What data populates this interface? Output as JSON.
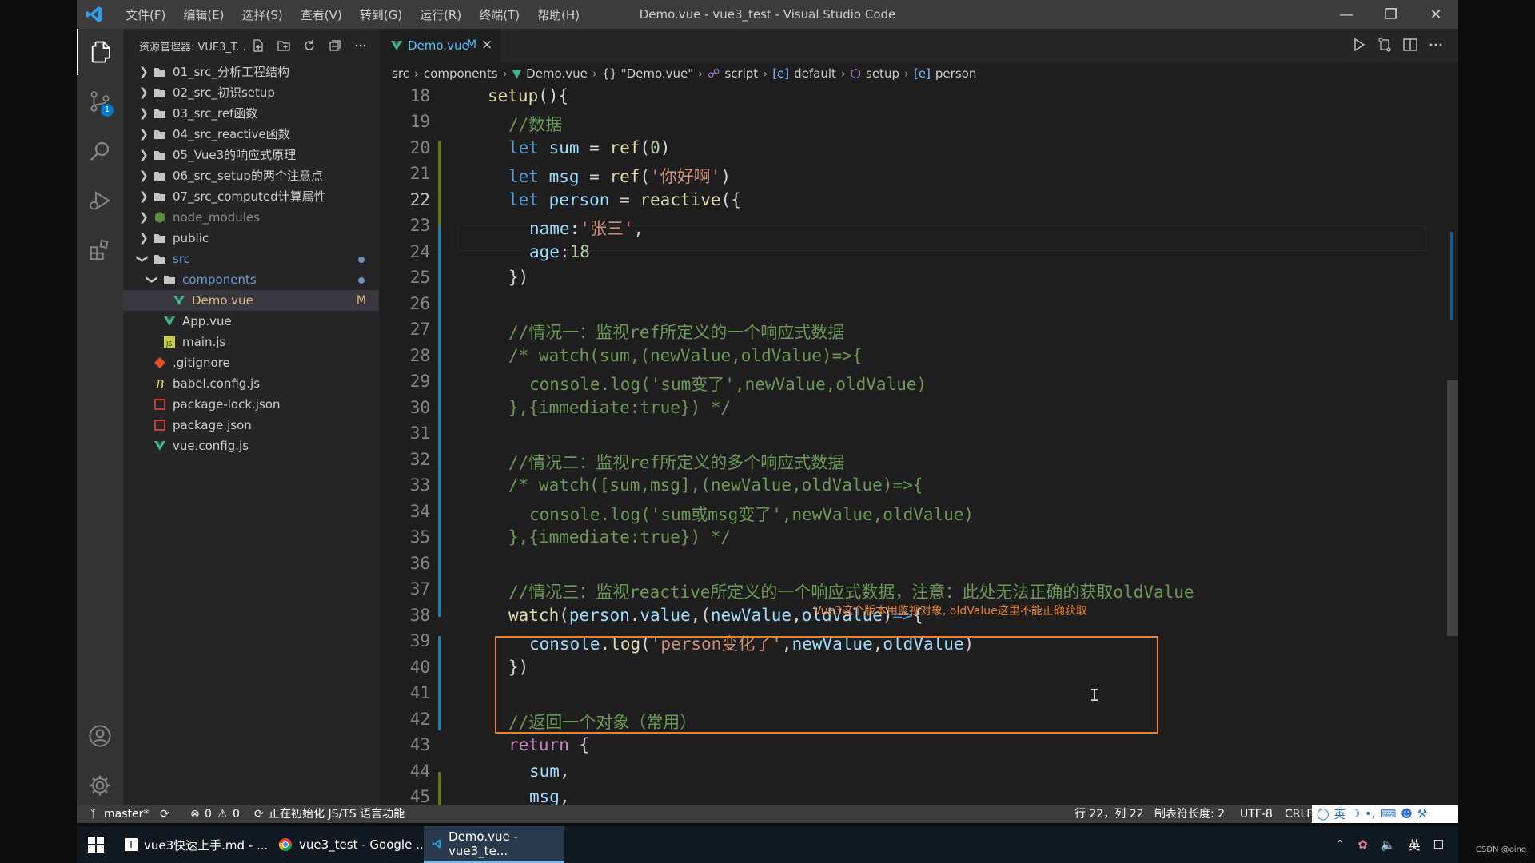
{
  "titlebar": {
    "menu": [
      "文件(F)",
      "编辑(E)",
      "选择(S)",
      "查看(V)",
      "转到(G)",
      "运行(R)",
      "终端(T)",
      "帮助(H)"
    ],
    "title": "Demo.vue - vue3_test - Visual Studio Code"
  },
  "activity": {
    "scm_badge": "1"
  },
  "sidebar": {
    "header": "资源管理器: VUE3_T...",
    "items": [
      {
        "label": "01_src_分析工程结构"
      },
      {
        "label": "02_src_初识setup"
      },
      {
        "label": "03_src_ref函数"
      },
      {
        "label": "04_src_reactive函数"
      },
      {
        "label": "05_Vue3的响应式原理"
      },
      {
        "label": "06_src_setup的两个注意点"
      },
      {
        "label": "07_src_computed计算属性"
      },
      {
        "label": "node_modules"
      },
      {
        "label": "public"
      },
      {
        "label": "src"
      },
      {
        "label": "components"
      },
      {
        "label": "Demo.vue",
        "badge": "M"
      },
      {
        "label": "App.vue"
      },
      {
        "label": "main.js"
      },
      {
        "label": ".gitignore"
      },
      {
        "label": "babel.config.js"
      },
      {
        "label": "package-lock.json"
      },
      {
        "label": "package.json"
      },
      {
        "label": "vue.config.js"
      }
    ]
  },
  "editor": {
    "tab": {
      "name": "Demo.vue",
      "modified": "M",
      "close": "×"
    },
    "breadcrumb": [
      "src",
      "components",
      "Demo.vue",
      "{} \"Demo.vue\"",
      "script",
      "default",
      "setup",
      "person"
    ],
    "line_numbers": [
      "18",
      "19",
      "20",
      "21",
      "22",
      "23",
      "24",
      "25",
      "26",
      "27",
      "28",
      "29",
      "30",
      "31",
      "32",
      "33",
      "34",
      "35",
      "36",
      "37",
      "38",
      "39",
      "40",
      "41",
      "42",
      "43",
      "44",
      "45"
    ],
    "annotation": "Vue3这个版本用监视对象, oldValue这里不能正确获取",
    "cursor_line": "22"
  },
  "statusbar": {
    "branch": "master*",
    "errors": "0",
    "warnings": "0",
    "init": "正在初始化 JS/TS 语言功能",
    "position": "行 22，列 22",
    "tab_size": "制表符长度: 2",
    "encoding": "UTF-8",
    "eol": "CRLF",
    "ime_lang": "英"
  },
  "taskbar": {
    "items": [
      "vue3快速上手.md - ...",
      "vue3_test - Google ...",
      "Demo.vue - vue3_te..."
    ],
    "tray_lang": "英"
  },
  "watermark": "CSDN @oing"
}
